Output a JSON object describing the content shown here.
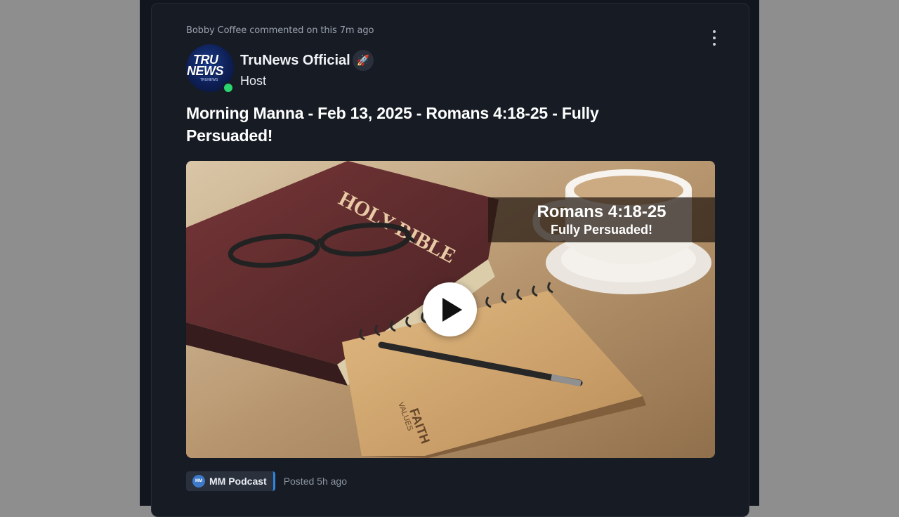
{
  "activity": {
    "text": "Bobby Coffee commented on this 7m ago"
  },
  "author": {
    "name": "TruNews Official",
    "role": "Host",
    "badge_icon": "rocket-icon",
    "online": true,
    "avatar_logo": {
      "line1": "TRU",
      "line2": "NEWS",
      "line3": "TRUNEWS"
    }
  },
  "post": {
    "title": "Morning Manna - Feb 13, 2025 - Romans 4:18-25 - Fully Persuaded!",
    "posted": "Posted 5h ago"
  },
  "media": {
    "overlay_title": "Romans 4:18-25",
    "overlay_subtitle": "Fully Persuaded!",
    "play_icon": "play-icon",
    "book_text": "HOLY BIBLE",
    "notebook_text_1": "FAITH",
    "notebook_text_2": "VALUES"
  },
  "category": {
    "label": "MM Podcast",
    "icon_text": "MM"
  },
  "menu": {
    "icon": "more-vertical-icon"
  },
  "colors": {
    "page_bg": "#8e8e8e",
    "card_bg": "#161b24",
    "accent": "#2f86e0",
    "online": "#2bd46e"
  }
}
